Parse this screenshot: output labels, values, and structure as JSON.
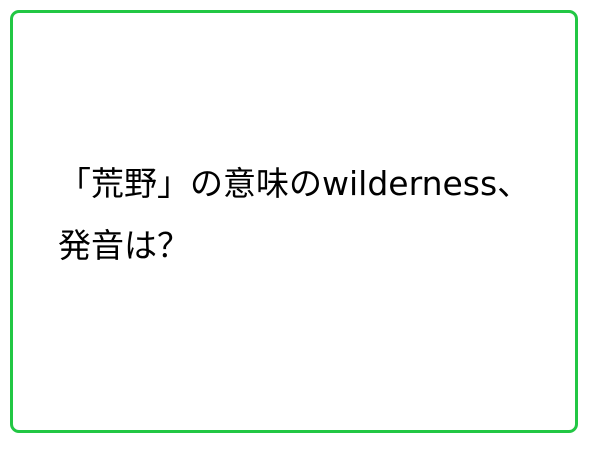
{
  "card": {
    "border_color": "#22c744",
    "lines": [
      "「荒野」の意味のwilderness、",
      "発音は？"
    ]
  }
}
